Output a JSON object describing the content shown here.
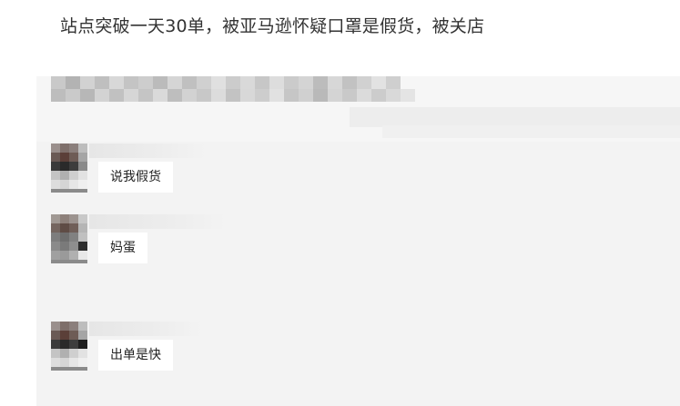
{
  "article": {
    "headline": "站点突破一天30单，被亚马逊怀疑口罩是假货，被关店"
  },
  "chat": {
    "messages": [
      {
        "text": "说我假货"
      },
      {
        "text": "妈蛋"
      },
      {
        "text": "出单是快"
      }
    ]
  },
  "colors": {
    "background": "#ffffff",
    "chat_background": "#f3f3f3",
    "bubble": "#ffffff",
    "headline_text": "#333333"
  }
}
